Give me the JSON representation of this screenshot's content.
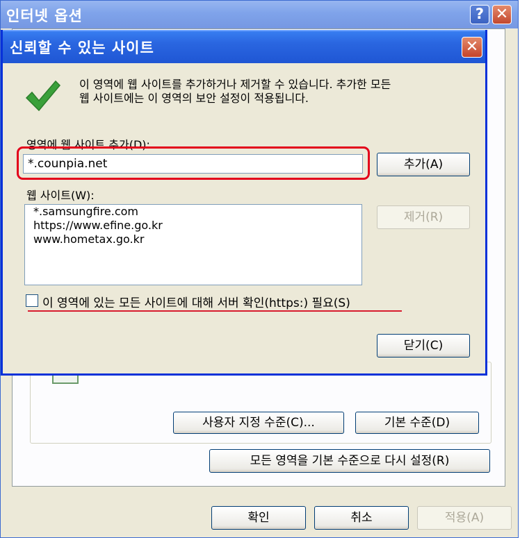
{
  "parent_window": {
    "title": "인터넷 옵션",
    "help_icon_glyph": "?",
    "close_icon_glyph": "✕",
    "buttons": {
      "custom_level": "사용자 지정 수준(C)...",
      "default_level": "기본 수준(D)",
      "reset_all": "모든 영역을 기본 수준으로 다시 설정(R)",
      "ok": "확인",
      "cancel": "취소",
      "apply": "적용(A)"
    }
  },
  "dialog": {
    "title": "신뢰할 수 있는 사이트",
    "close_icon_glyph": "✕",
    "description_line1": "이 영역에 웹 사이트를 추가하거나 제거할 수 있습니다. 추가한 모든",
    "description_line2": "웹 사이트에는 이 영역의 보안 설정이 적용됩니다.",
    "add_label": "영역에 웹 사이트 추가(D):",
    "add_input_value": "*.counpia.net",
    "add_button": "추가(A)",
    "sites_label": "웹 사이트(W):",
    "sites": [
      "*.samsungfire.com",
      "https://www.efine.go.kr",
      "www.hometax.go.kr"
    ],
    "remove_button": "제거(R)",
    "https_checkbox_label": "이 영역에 있는 모든 사이트에 대해 서버 확인(https:) 필요(S)",
    "https_checkbox_checked": false,
    "close_button": "닫기(C)"
  },
  "colors": {
    "dialog_titlebar": "#2a66e0",
    "parent_titlebar": "#7fa3ea",
    "highlight_red": "#e3001b",
    "check_green": "#3aa03a"
  },
  "icons": [
    "help-icon",
    "close-icon",
    "checkmark-icon"
  ]
}
